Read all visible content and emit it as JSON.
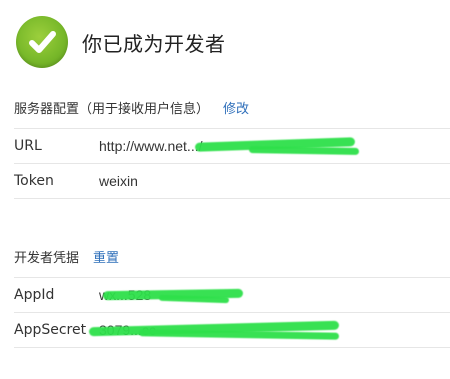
{
  "header": {
    "title": "你已成为开发者"
  },
  "server_config": {
    "heading": "服务器配置（用于接收用户信息）",
    "edit_link": "修改",
    "rows": [
      {
        "label": "URL",
        "value": "http://www.net.../"
      },
      {
        "label": "Token",
        "value": "weixin"
      }
    ]
  },
  "credentials": {
    "heading": "开发者凭据",
    "reset_link": "重置",
    "rows": [
      {
        "label": "AppId",
        "value": "wx...528"
      },
      {
        "label": "AppSecret",
        "value": "3079...cc"
      }
    ]
  },
  "colors": {
    "accent_link": "#2f6fba",
    "check_green": "#79b92a",
    "redaction_green": "#2ee04a"
  }
}
